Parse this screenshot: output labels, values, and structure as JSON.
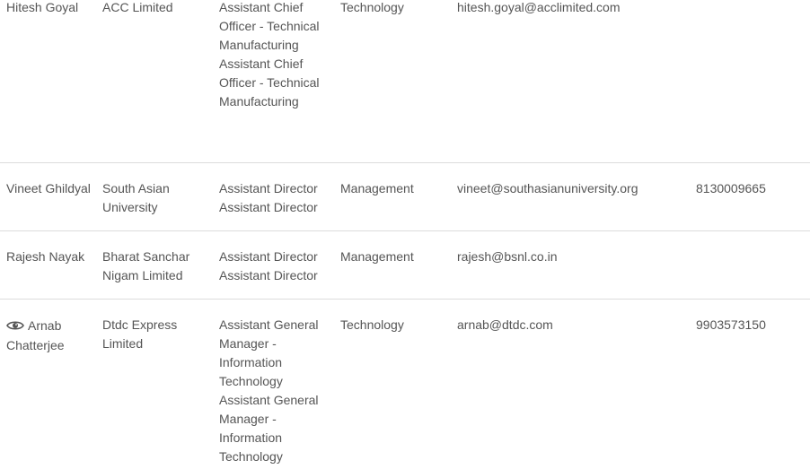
{
  "contacts": [
    {
      "name": "Hitesh Goyal",
      "company": "ACC Limited",
      "title_lines": [
        "Assistant Chief Officer - Technical Manufacturing",
        "Assistant Chief Officer - Technical Manufacturing"
      ],
      "department": "Technology",
      "email": "hitesh.goyal@acclimited.com",
      "phone": ""
    },
    {
      "name": "Vineet Ghildyal",
      "company": "South Asian University",
      "title_lines": [
        "Assistant Director",
        "Assistant Director"
      ],
      "department": "Management",
      "email": "vineet@southasianuniversity.org",
      "phone": "8130009665"
    },
    {
      "name": "Rajesh Nayak",
      "company": "Bharat Sanchar Nigam Limited",
      "title_lines": [
        "Assistant Director",
        "Assistant Director"
      ],
      "department": "Management",
      "email": "rajesh@bsnl.co.in",
      "phone": ""
    },
    {
      "name": "Arnab Chatterjee",
      "company": "Dtdc Express Limited",
      "title_lines": [
        "Assistant General Manager - Information Technology",
        "Assistant General Manager - Information Technology"
      ],
      "department": "Technology",
      "email": "arnab@dtdc.com",
      "phone": "9903573150",
      "icon": "eye-icon"
    }
  ]
}
